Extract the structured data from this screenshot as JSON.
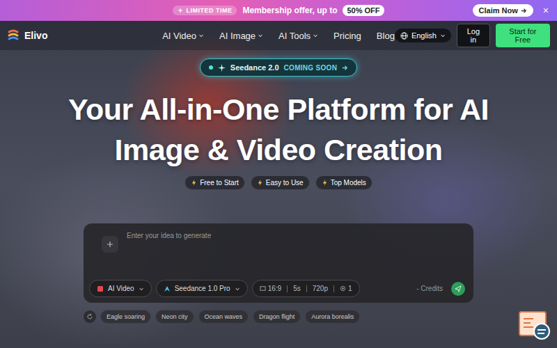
{
  "promo": {
    "badge": "LIMITED TIME",
    "message": "Membership offer, up to",
    "discount": "50% OFF",
    "cta": "Claim Now",
    "close": "×"
  },
  "nav": {
    "brand": "Elivo",
    "menu": [
      {
        "label": "AI Video",
        "dropdown": true
      },
      {
        "label": "AI Image",
        "dropdown": true
      },
      {
        "label": "AI Tools",
        "dropdown": true
      },
      {
        "label": "Pricing",
        "dropdown": false
      },
      {
        "label": "Blog",
        "dropdown": false
      }
    ],
    "language": "English",
    "login": "Log in",
    "signup": "Start for Free"
  },
  "hero": {
    "announcement": {
      "label": "Seedance 2.0",
      "status": "COMING SOON"
    },
    "title_lines": [
      "Your All-in-One Platform for AI",
      "Image & Video Creation"
    ],
    "features": [
      "Free to Start",
      "Easy to Use",
      "Top Models"
    ]
  },
  "prompt": {
    "placeholder": "Enter your idea to generate",
    "mode": "AI Video",
    "model": "Seedance 1.0 Pro",
    "settings": {
      "ratio": "16:9",
      "duration": "5s",
      "resolution": "720p",
      "count": "1"
    },
    "credits": "- Credits"
  },
  "suggestions": [
    "Eagle soaring",
    "Neon city",
    "Ocean waves",
    "Dragon flight",
    "Aurora borealis"
  ]
}
